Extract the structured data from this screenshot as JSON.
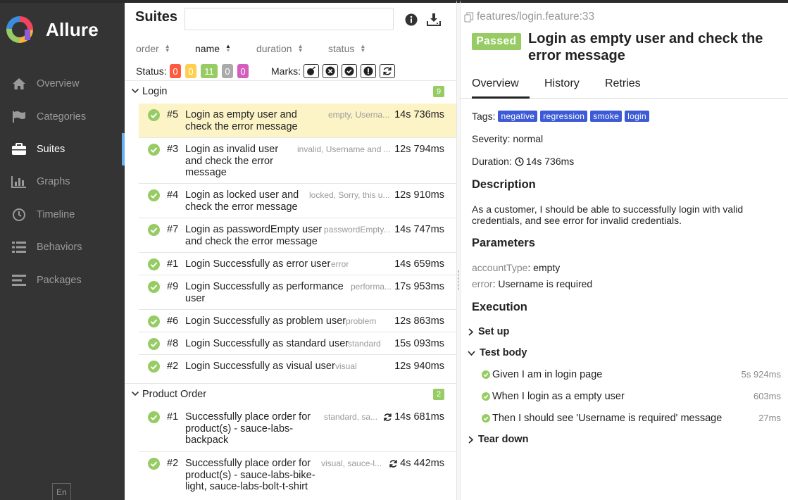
{
  "brand": {
    "name": "Allure"
  },
  "sidebar": {
    "items": [
      {
        "label": "Overview",
        "icon": "home-icon",
        "active": false
      },
      {
        "label": "Categories",
        "icon": "flag-icon",
        "active": false
      },
      {
        "label": "Suites",
        "icon": "briefcase-icon",
        "active": true
      },
      {
        "label": "Graphs",
        "icon": "bar-chart-icon",
        "active": false
      },
      {
        "label": "Timeline",
        "icon": "clock-icon",
        "active": false
      },
      {
        "label": "Behaviors",
        "icon": "list-icon",
        "active": false
      },
      {
        "label": "Packages",
        "icon": "align-left-icon",
        "active": false
      }
    ],
    "language": "En"
  },
  "suites": {
    "title": "Suites",
    "search": {
      "value": "",
      "placeholder": ""
    },
    "sorters": [
      "order",
      "name",
      "duration",
      "status"
    ],
    "status_label": "Status:",
    "status_counts": [
      {
        "value": "0",
        "color": "#fd5a3e"
      },
      {
        "value": "0",
        "color": "#ffd050"
      },
      {
        "value": "11",
        "color": "#97cc64"
      },
      {
        "value": "0",
        "color": "#aaaaaa"
      },
      {
        "value": "0",
        "color": "#d35ebe"
      }
    ],
    "marks_label": "Marks:",
    "groups": [
      {
        "name": "Login",
        "count": "9",
        "tests": [
          {
            "num": "#5",
            "name": "Login as empty user and check the error message",
            "params": "empty, Userna...",
            "duration": "14s 736ms",
            "selected": true,
            "retry": false
          },
          {
            "num": "#3",
            "name": "Login as invalid user and check the error message",
            "params": "invalid, Username and ...",
            "duration": "12s 794ms",
            "selected": false,
            "retry": false
          },
          {
            "num": "#4",
            "name": "Login as locked user and check the error message",
            "params": "locked, Sorry, this u...",
            "duration": "12s 910ms",
            "selected": false,
            "retry": false
          },
          {
            "num": "#7",
            "name": "Login as passwordEmpty user and check the error message",
            "params": "passwordEmpty...",
            "duration": "14s 747ms",
            "selected": false,
            "retry": false
          },
          {
            "num": "#1",
            "name": "Login Successfully as error user",
            "params": "error",
            "duration": "14s 659ms",
            "selected": false,
            "retry": false
          },
          {
            "num": "#9",
            "name": "Login Successfully as performance user",
            "params": "performa...",
            "duration": "17s 953ms",
            "selected": false,
            "retry": false
          },
          {
            "num": "#6",
            "name": "Login Successfully as problem user",
            "params": "problem",
            "duration": "12s 863ms",
            "selected": false,
            "retry": false
          },
          {
            "num": "#8",
            "name": "Login Successfully as standard user",
            "params": "standard",
            "duration": "15s 093ms",
            "selected": false,
            "retry": false
          },
          {
            "num": "#2",
            "name": "Login Successfully as visual user",
            "params": "visual",
            "duration": "12s 940ms",
            "selected": false,
            "retry": false
          }
        ]
      },
      {
        "name": "Product Order",
        "count": "2",
        "tests": [
          {
            "num": "#1",
            "name": "Successfully place order for product(s) - sauce-labs-backpack",
            "params": "standard, sa...",
            "duration": "14s 681ms",
            "selected": false,
            "retry": true
          },
          {
            "num": "#2",
            "name": "Successfully place order for product(s) - sauce-labs-bike-light, sauce-labs-bolt-t-shirt",
            "params": "visual, sauce-l...",
            "duration": "4s 442ms",
            "selected": false,
            "retry": true
          }
        ]
      }
    ]
  },
  "detail": {
    "path": "features/login.feature:33",
    "status": "Passed",
    "title": "Login as empty user and check the error message",
    "tabs": [
      "Overview",
      "History",
      "Retries"
    ],
    "tags_label": "Tags:",
    "tags": [
      "negative",
      "regression",
      "smoke",
      "login"
    ],
    "severity": "Severity: normal",
    "duration_label": "Duration:",
    "duration": "14s 736ms",
    "description_heading": "Description",
    "description": "As a customer, I should be able to successfully login with valid credentials, and see error for invalid credentials.",
    "parameters_heading": "Parameters",
    "parameters": [
      {
        "key": "accountType",
        "value": ": empty"
      },
      {
        "key": "error",
        "value": ": Username is required"
      }
    ],
    "execution_heading": "Execution",
    "setup": "Set up",
    "test_body": "Test body",
    "steps": [
      {
        "text": "Given I am in login page",
        "duration": "5s 924ms"
      },
      {
        "text": "When I login as a empty user",
        "duration": "603ms"
      },
      {
        "text": "Then I should see 'Username is required' message",
        "duration": "27ms"
      }
    ],
    "teardown": "Tear down"
  },
  "colors": {
    "passed": "#97cc64",
    "tag": "#3d5bd6",
    "selected_row": "#fcf4c6",
    "sidebar_bg": "#343434",
    "active_marker": "#68b0f3"
  }
}
